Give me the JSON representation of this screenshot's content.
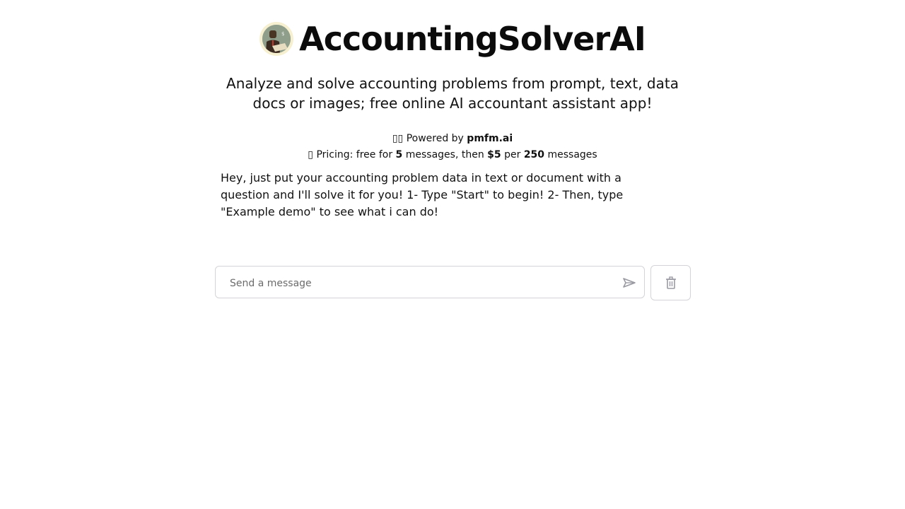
{
  "header": {
    "logo_icon": "accountant-avatar-icon",
    "title": "AccountingSolverAI"
  },
  "subtitle": "Analyze and solve accounting problems from prompt, text, data docs or images; free online AI accountant assistant app!",
  "powered": {
    "prefix_icon": "unknown-glyph",
    "text": "Powered by ",
    "brand": "pmfm.ai"
  },
  "pricing": {
    "prefix_icon": "unknown-glyph",
    "text1": "Pricing: free for ",
    "free_count": "5",
    "text2": " messages, then ",
    "price": "$5",
    "text3": " per ",
    "paid_count": "250",
    "text4": " messages"
  },
  "intro_message": "Hey, just put your accounting problem data in text or document with a question and I'll solve it for you! 1- Type \"Start\" to begin! 2- Then, type \"Example demo\" to see what i can do!",
  "composer": {
    "placeholder": "Send a message",
    "value": "",
    "send_icon": "send-icon",
    "clear_icon": "trash-icon"
  }
}
